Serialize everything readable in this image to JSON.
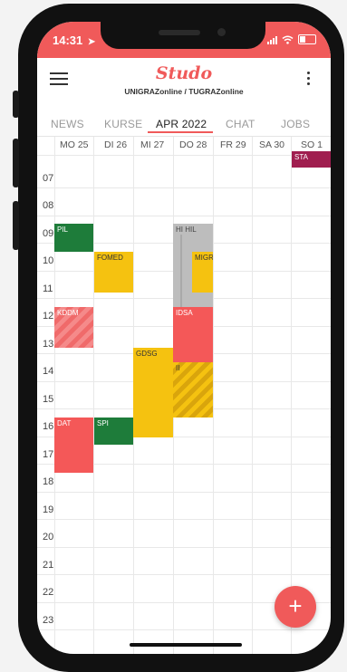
{
  "status": {
    "time": "14:31",
    "location_icon": "location-arrow-icon",
    "signal_icon": "signal-icon",
    "wifi_icon": "wifi-icon",
    "battery_icon": "battery-icon"
  },
  "header": {
    "logo": "Studo",
    "subtitle": "UNIGRAZonline / TUGRAZonline",
    "menu_icon": "hamburger-icon",
    "more_icon": "more-vertical-icon"
  },
  "tabs": [
    {
      "label": "NEWS"
    },
    {
      "label": "KURSE"
    },
    {
      "label": "APR 2022",
      "active": true
    },
    {
      "label": "CHAT"
    },
    {
      "label": "JOBS"
    }
  ],
  "calendar": {
    "days": [
      "MO 25",
      "DI 26",
      "MI 27",
      "DO 28",
      "FR 29",
      "SA 30",
      "SO 1"
    ],
    "hours": [
      "07",
      "08",
      "09",
      "10",
      "11",
      "12",
      "13",
      "14",
      "15",
      "16",
      "17",
      "18",
      "19",
      "20",
      "21",
      "22",
      "23"
    ],
    "events": [
      {
        "label": "PIL",
        "color": "#1e7c3a"
      },
      {
        "label": "FOMED",
        "color": "#f5c210"
      },
      {
        "label": "HI HIL",
        "color": "#bdbdbd"
      },
      {
        "label": "MIGR",
        "color": "#f5c210"
      },
      {
        "label": "KDDM",
        "color": "#f06a6a"
      },
      {
        "label": "IDSA",
        "color": "#f45858"
      },
      {
        "label": "GDSG",
        "color": "#f5c210"
      },
      {
        "label": "II",
        "color": "#f5c210"
      },
      {
        "label": "DAT",
        "color": "#f45858"
      },
      {
        "label": "SPI",
        "color": "#1e7c3a"
      },
      {
        "label": "STA",
        "color": "#a01e4f"
      }
    ]
  },
  "fab": {
    "label": "+"
  },
  "colors": {
    "accent": "#f05a5a"
  }
}
